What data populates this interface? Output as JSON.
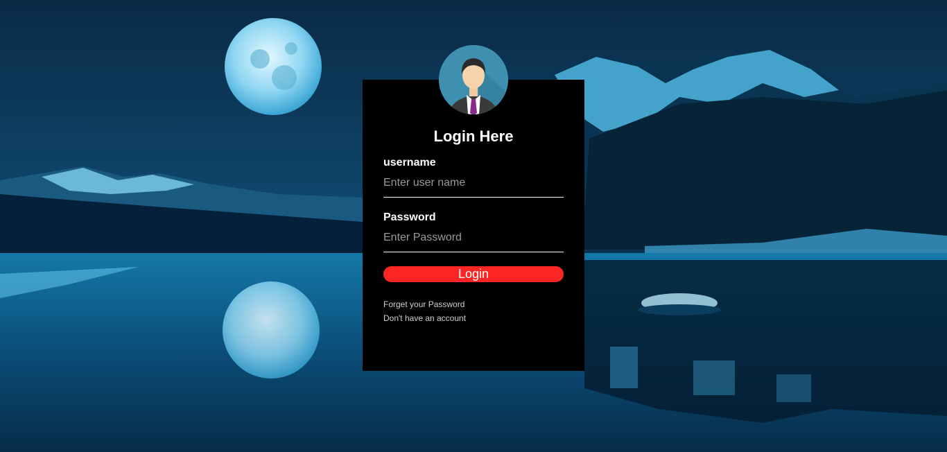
{
  "background": {
    "scene": "night-lake-full-moon-mountains"
  },
  "login": {
    "avatar_icon": "user-avatar-icon",
    "title": "Login Here",
    "username": {
      "label": "username",
      "placeholder": "Enter user name",
      "value": ""
    },
    "password": {
      "label": "Password",
      "placeholder": "Enter Password",
      "value": ""
    },
    "button_label": "Login",
    "forgot_link": "Forget your Password",
    "signup_link": "Don't have an account"
  },
  "colors": {
    "box_background": "#000000",
    "button": "#fb2525",
    "avatar_bg": "#3f8fb0"
  }
}
